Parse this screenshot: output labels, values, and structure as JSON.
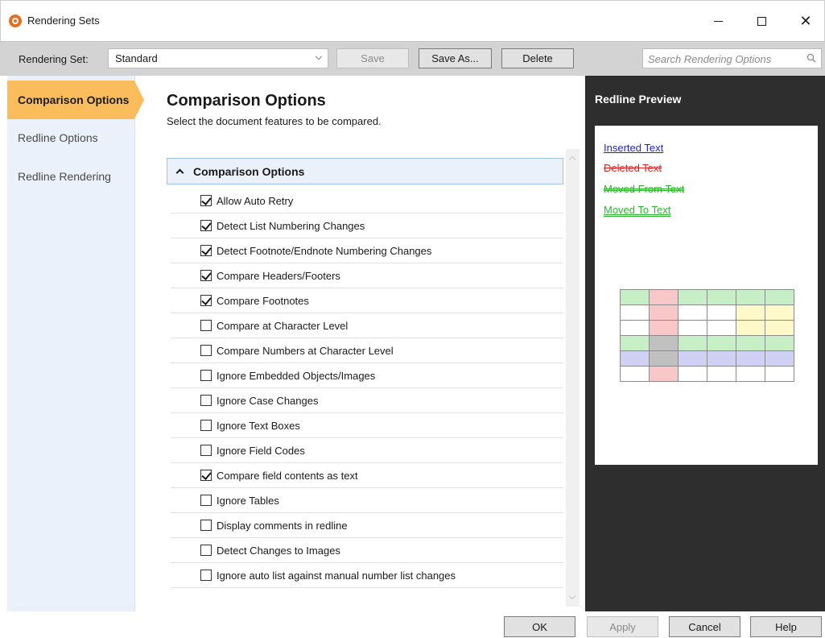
{
  "window": {
    "title": "Rendering Sets"
  },
  "toolbar": {
    "rendering_set_label": "Rendering Set:",
    "rendering_set_value": "Standard",
    "save_label": "Save",
    "save_as_label": "Save As...",
    "delete_label": "Delete",
    "search_placeholder": "Search Rendering Options"
  },
  "sidebar": {
    "items": [
      {
        "label": "Comparison Options",
        "active": true
      },
      {
        "label": "Redline Options",
        "active": false
      },
      {
        "label": "Redline Rendering",
        "active": false
      }
    ]
  },
  "main": {
    "title": "Comparison Options",
    "subtitle": "Select the document features to be compared.",
    "section_header": "Comparison Options",
    "options": [
      {
        "label": "Allow Auto Retry",
        "checked": true
      },
      {
        "label": "Detect List Numbering Changes",
        "checked": true
      },
      {
        "label": "Detect Footnote/Endnote Numbering Changes",
        "checked": true
      },
      {
        "label": "Compare Headers/Footers",
        "checked": true
      },
      {
        "label": "Compare Footnotes",
        "checked": true
      },
      {
        "label": "Compare at Character Level",
        "checked": false
      },
      {
        "label": "Compare Numbers at Character Level",
        "checked": false
      },
      {
        "label": "Ignore Embedded Objects/Images",
        "checked": false
      },
      {
        "label": "Ignore Case Changes",
        "checked": false
      },
      {
        "label": "Ignore Text Boxes",
        "checked": false
      },
      {
        "label": "Ignore Field Codes",
        "checked": false
      },
      {
        "label": "Compare field contents as text",
        "checked": true
      },
      {
        "label": "Ignore Tables",
        "checked": false
      },
      {
        "label": "Display comments in redline",
        "checked": false
      },
      {
        "label": "Detect Changes to Images",
        "checked": false
      },
      {
        "label": "Ignore auto list against manual number list changes",
        "checked": false
      }
    ]
  },
  "preview": {
    "title": "Redline Preview",
    "inserted_text": "Inserted Text",
    "deleted_text": "Deleted Text",
    "moved_from_text": "Moved From Text",
    "moved_to_text": "Moved To Text",
    "colors": {
      "inserted": "#1a1aff",
      "deleted": "#e52020",
      "moved": "#2db52d",
      "row_inserted": "#c6efc6",
      "col_deleted": "#f8c8c8",
      "cell_merged": "#fff8c8",
      "row_moved": "#d0d0f4",
      "cell_grey": "#c0c0c0"
    },
    "table_cells": [
      [
        "#c6efc6",
        "#f8c8c8",
        "#c6efc6",
        "#c6efc6",
        "#c6efc6",
        "#c6efc6"
      ],
      [
        "#ffffff",
        "#f8c8c8",
        "#ffffff",
        "#ffffff",
        "#fff8c8",
        "#fff8c8"
      ],
      [
        "#ffffff",
        "#f8c8c8",
        "#ffffff",
        "#ffffff",
        "#fff8c8",
        "#fff8c8"
      ],
      [
        "#c6efc6",
        "#c0c0c0",
        "#c6efc6",
        "#c6efc6",
        "#c6efc6",
        "#c6efc6"
      ],
      [
        "#d0d0f4",
        "#c0c0c0",
        "#d0d0f4",
        "#d0d0f4",
        "#d0d0f4",
        "#d0d0f4"
      ],
      [
        "#ffffff",
        "#f8c8c8",
        "#ffffff",
        "#ffffff",
        "#ffffff",
        "#ffffff"
      ]
    ]
  },
  "footer": {
    "ok_label": "OK",
    "apply_label": "Apply",
    "cancel_label": "Cancel",
    "help_label": "Help"
  }
}
